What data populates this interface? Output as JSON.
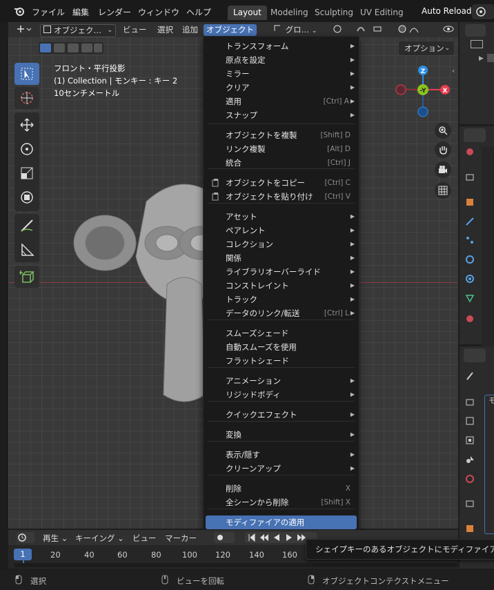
{
  "topbar": {
    "menus": [
      "ファイル",
      "編集",
      "レンダー",
      "ウィンドウ",
      "ヘルプ"
    ],
    "workspaces": [
      "Layout",
      "Modeling",
      "Sculpting",
      "UV Editing"
    ],
    "auto_reload": "Auto Reload"
  },
  "viewport_header": {
    "mode": "オブジェク…",
    "view": "ビュー",
    "select": "選択",
    "add": "追加",
    "object": "オブジェクト",
    "transform_orientation": "グロ…",
    "options": "オプション"
  },
  "viewport_info": {
    "line1": "フロント・平行投影",
    "line2": "(1) Collection | モンキー : キー 2",
    "line3": "10センチメートル"
  },
  "gizmo": {
    "z": "Z",
    "y": "-Y",
    "x": "X"
  },
  "object_menu": {
    "group1": [
      {
        "label": "トランスフォーム",
        "sub": true
      },
      {
        "label": "原点を設定",
        "sub": true
      },
      {
        "label": "ミラー",
        "sub": true
      },
      {
        "label": "クリア",
        "sub": true
      },
      {
        "label": "適用",
        "shortcut": "[Ctrl] A",
        "sub": true
      },
      {
        "label": "スナップ",
        "sub": true
      }
    ],
    "group2": [
      {
        "label": "オブジェクトを複製",
        "shortcut": "[Shift] D"
      },
      {
        "label": "リンク複製",
        "shortcut": "[Alt] D"
      },
      {
        "label": "統合",
        "shortcut": "[Ctrl] J"
      }
    ],
    "group3": [
      {
        "label": "オブジェクトをコピー",
        "shortcut": "[Ctrl] C"
      },
      {
        "label": "オブジェクトを貼り付け",
        "shortcut": "[Ctrl] V"
      }
    ],
    "group4": [
      {
        "label": "アセット",
        "sub": true
      },
      {
        "label": "ペアレント",
        "sub": true
      },
      {
        "label": "コレクション",
        "sub": true
      },
      {
        "label": "関係",
        "sub": true
      },
      {
        "label": "ライブラリオーバーライド",
        "sub": true
      },
      {
        "label": "コンストレイント",
        "sub": true
      },
      {
        "label": "トラック",
        "sub": true
      },
      {
        "label": "データのリンク/転送",
        "shortcut": "[Ctrl] L",
        "sub": true
      }
    ],
    "group5": [
      {
        "label": "スムーズシェード"
      },
      {
        "label": "自動スムーズを使用"
      },
      {
        "label": "フラットシェード"
      }
    ],
    "group6": [
      {
        "label": "アニメーション",
        "sub": true
      },
      {
        "label": "リジッドボディ",
        "sub": true
      }
    ],
    "group7": [
      {
        "label": "クイックエフェクト",
        "sub": true
      }
    ],
    "group8": [
      {
        "label": "変換",
        "sub": true
      }
    ],
    "group9": [
      {
        "label": "表示/隠す",
        "sub": true
      },
      {
        "label": "クリーンアップ",
        "sub": true
      }
    ],
    "group10": [
      {
        "label": "削除",
        "shortcut": "X"
      },
      {
        "label": "全シーンから削除",
        "shortcut": "[Shift] X"
      }
    ],
    "highlighted": "モディファイアの適用"
  },
  "timeline": {
    "playback": "再生",
    "keying": "キーイング",
    "view": "ビュー",
    "marker": "マーカー",
    "current_frame": "1",
    "ticks": [
      "20",
      "40",
      "60",
      "80",
      "100",
      "120",
      "140",
      "160"
    ]
  },
  "tooltip": "シェイプキーのあるオブジェクトにモディファイアを",
  "statusbar": {
    "select": "選択",
    "rotate": "ビューを回転",
    "context": "オブジェクトコンテクストメニュー"
  },
  "right_panel": {
    "mo_label": "モ"
  },
  "colors": {
    "accent": "#4772b3",
    "x_axis": "#e63b4e",
    "y_axis": "#8bc21c",
    "z_axis": "#2c8ee6"
  }
}
